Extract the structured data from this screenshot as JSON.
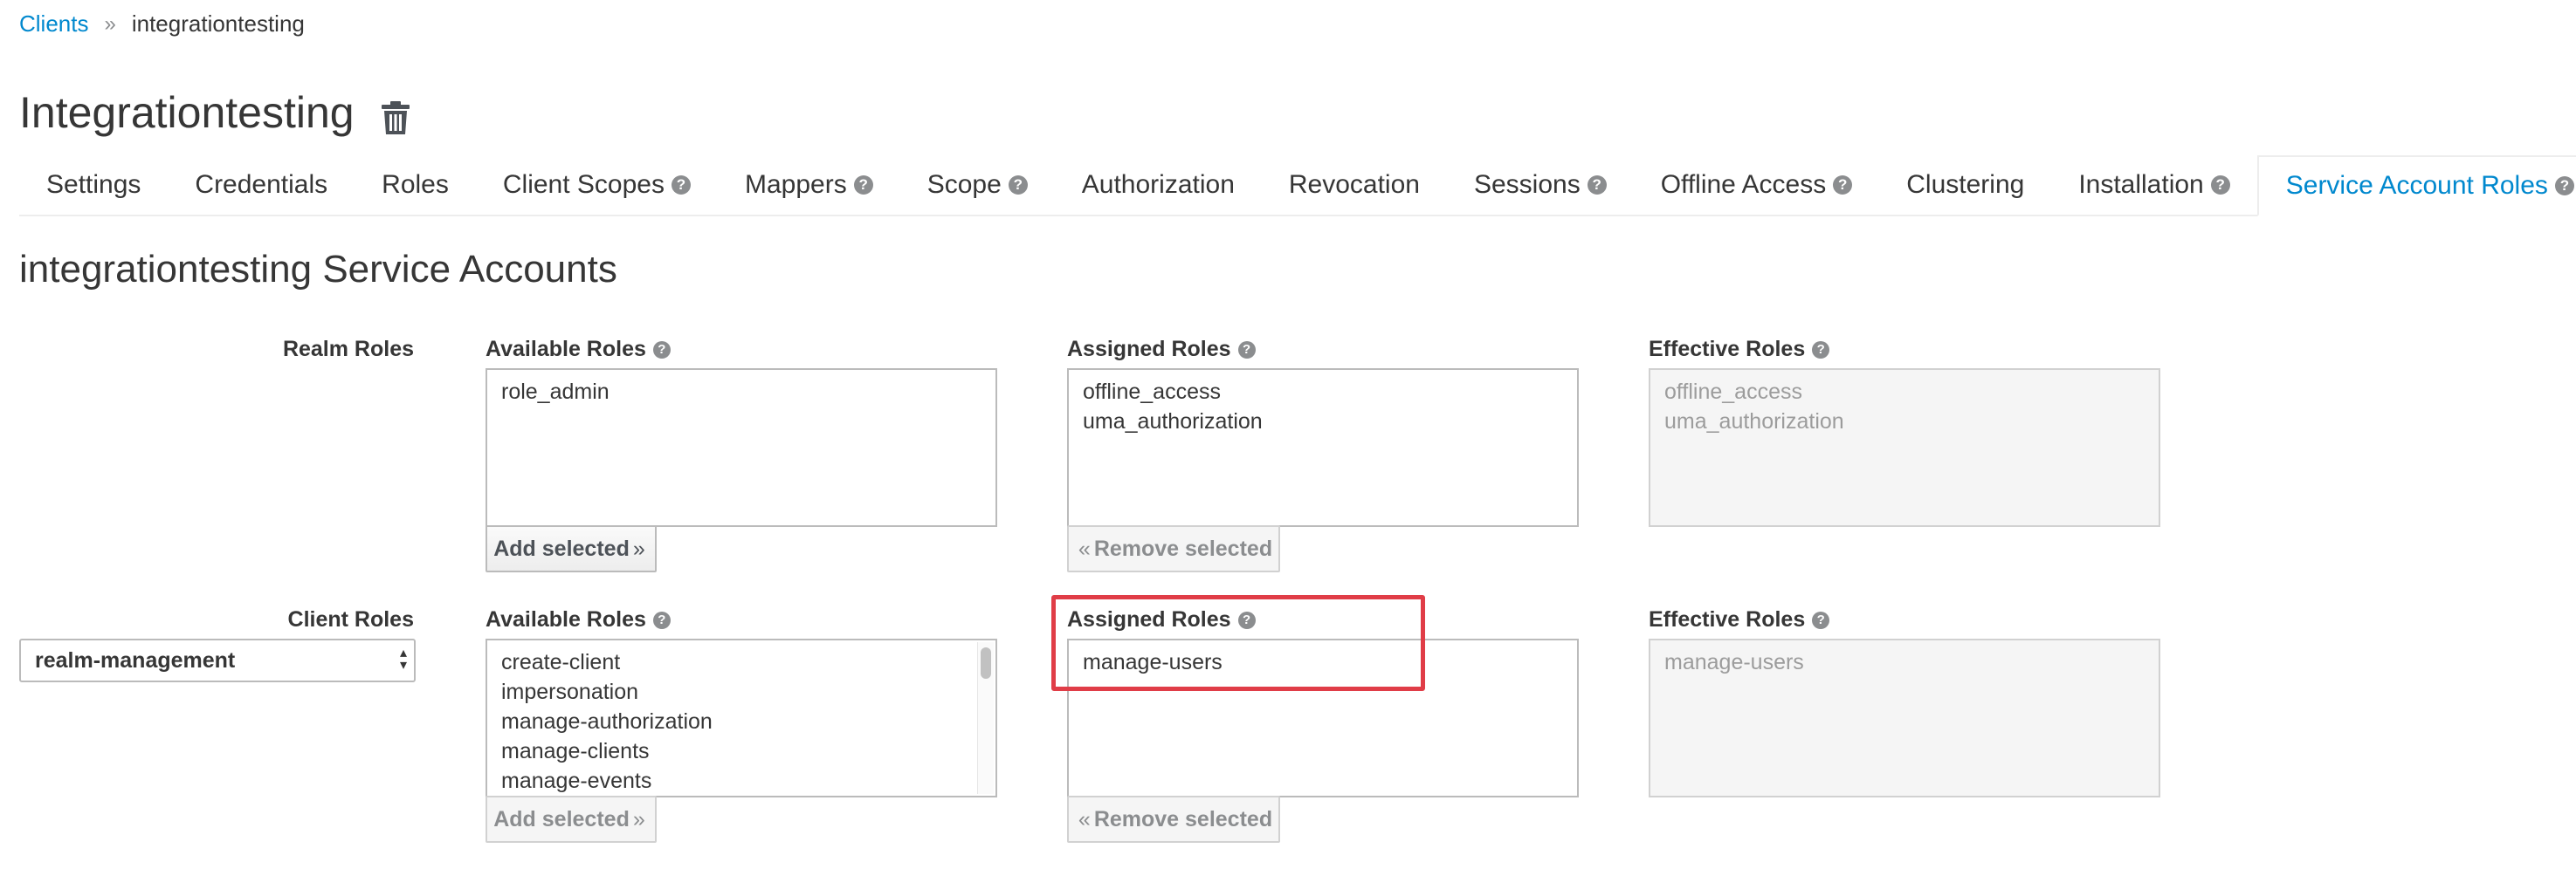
{
  "breadcrumb": {
    "parent": "Clients",
    "separator": "»",
    "current": "integrationtesting"
  },
  "page": {
    "title": "Integrationtesting"
  },
  "tabs": [
    {
      "label": "Settings",
      "help": false
    },
    {
      "label": "Credentials",
      "help": false
    },
    {
      "label": "Roles",
      "help": false
    },
    {
      "label": "Client Scopes",
      "help": true
    },
    {
      "label": "Mappers",
      "help": true
    },
    {
      "label": "Scope",
      "help": true
    },
    {
      "label": "Authorization",
      "help": false
    },
    {
      "label": "Revocation",
      "help": false
    },
    {
      "label": "Sessions",
      "help": true
    },
    {
      "label": "Offline Access",
      "help": true
    },
    {
      "label": "Clustering",
      "help": false
    },
    {
      "label": "Installation",
      "help": true
    },
    {
      "label": "Service Account Roles",
      "help": true,
      "active": true
    }
  ],
  "section": {
    "title": "integrationtesting Service Accounts"
  },
  "realm_roles": {
    "label": "Realm Roles",
    "available_label": "Available Roles",
    "assigned_label": "Assigned Roles",
    "effective_label": "Effective Roles",
    "available": [
      "role_admin"
    ],
    "assigned": [
      "offline_access",
      "uma_authorization"
    ],
    "effective": [
      "offline_access",
      "uma_authorization"
    ],
    "add_button": "Add selected",
    "remove_button": "Remove selected"
  },
  "client_roles": {
    "label": "Client Roles",
    "client_select": "realm-management",
    "available_label": "Available Roles",
    "assigned_label": "Assigned Roles",
    "effective_label": "Effective Roles",
    "available": [
      "create-client",
      "impersonation",
      "manage-authorization",
      "manage-clients",
      "manage-events"
    ],
    "assigned": [
      "manage-users"
    ],
    "effective": [
      "manage-users"
    ],
    "add_button": "Add selected",
    "remove_button": "Remove selected"
  },
  "colors": {
    "link": "#0088ce",
    "highlight": "#e03d47",
    "text": "#363636"
  },
  "icons": {
    "delete": "trash-icon",
    "help": "question-circle-icon",
    "breadcrumb_sep": "double-chevron-right-icon"
  }
}
